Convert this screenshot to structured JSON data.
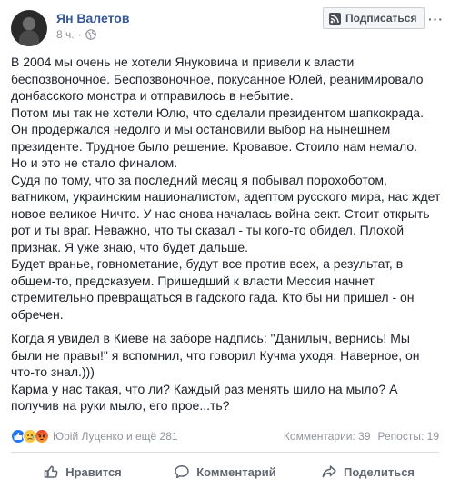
{
  "header": {
    "author": "Ян Валетов",
    "time": "8 ч.",
    "privacy_icon": "globe-icon",
    "subscribe_label": "Подписаться",
    "more_label": "···"
  },
  "post": {
    "paragraphs": [
      [
        "В 2004 мы очень не хотели Януковича и привели к власти",
        "беспозвоночное. Беспозвоночное, покусанное Юлей, реанимировало",
        "донбасского монстра и отправилось в небытие.",
        "Потом мы так не хотели Юлю, что сделали президентом шапкокрада.",
        "Он продержался недолго и мы остановили выбор на нынешнем",
        "президенте. Трудное было решение. Кровавое. Стоило нам немало.",
        "Но и это не стало финалом.",
        "Судя по тому, что за последний месяц я побывал порохоботом,",
        "ватником, украинским националистом, адептом русского мира, нас ждет",
        "новое великое Ничто. У нас снова началась война сект. Стоит открыть",
        "рот и ты враг. Неважно, что ты сказал - ты кого-то обидел. Плохой",
        "признак. Я уже знаю, что будет дальше.",
        "Будет вранье, говнометание, будут все против всех, а результат, в",
        "общем-то, предсказуем. Пришедший к власти Мессия начнет",
        "стремительно превращаться в гадского гада. Кто бы ни пришел - он",
        "обречен."
      ],
      [
        "Когда я увидел в Киеве на заборе надпись: \"Данилыч, вернись! Мы",
        "были не правы!\" я вспомнил, что говорил Кучма уходя. Наверное, он",
        "что-то знал.)))",
        "Карма у нас такая, что ли? Каждый раз менять шило на мыло? А",
        "получив на руки мыло, его прое...ть?"
      ]
    ]
  },
  "reactions": {
    "icons": [
      "like-reaction-icon",
      "sad-reaction-icon",
      "angry-reaction-icon"
    ],
    "names": "Юрій Луценко и ещё 281",
    "comments": "Комментарии: 39",
    "reposts": "Репосты: 19"
  },
  "actions": {
    "like_label": "Нравится",
    "comment_label": "Комментарий",
    "share_label": "Поделиться"
  },
  "colors": {
    "link": "#365899",
    "muted": "#90949c",
    "action": "#606770",
    "like_blue": "#2078f4"
  }
}
